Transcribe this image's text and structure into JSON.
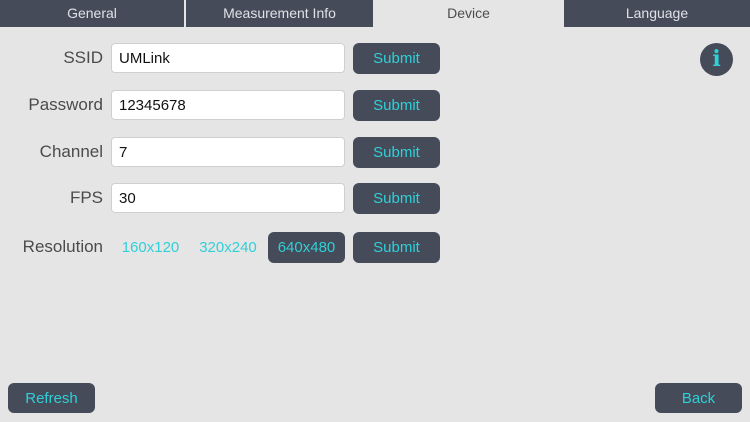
{
  "tabs": [
    {
      "label": "General"
    },
    {
      "label": "Measurement Info"
    },
    {
      "label": "Device"
    },
    {
      "label": "Language"
    }
  ],
  "active_tab": "Device",
  "form": {
    "ssid": {
      "label": "SSID",
      "value": "UMLink"
    },
    "password": {
      "label": "Password",
      "value": "12345678"
    },
    "channel": {
      "label": "Channel",
      "value": "7"
    },
    "fps": {
      "label": "FPS",
      "value": "30"
    },
    "resolution": {
      "label": "Resolution",
      "options": [
        "160x120",
        "320x240",
        "640x480"
      ],
      "selected": "640x480"
    }
  },
  "submit_label": "Submit",
  "info_glyph": "i",
  "footer": {
    "refresh_label": "Refresh",
    "back_label": "Back"
  },
  "colors": {
    "accent": "#2fd0d8",
    "dark": "#454b59",
    "background": "#e5e5e5"
  }
}
